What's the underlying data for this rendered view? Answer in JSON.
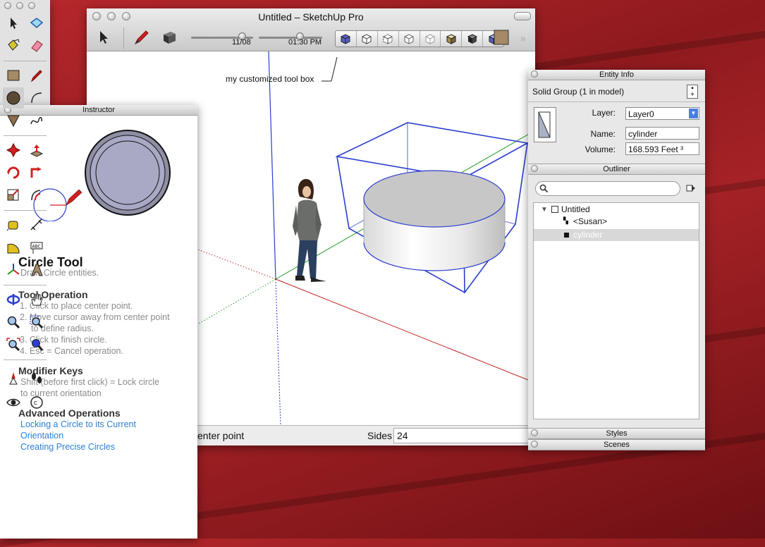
{
  "main_window": {
    "title": "Untitled – SketchUp Pro",
    "date_label": "11/08",
    "time_label": "01:30 PM",
    "callout": "my customized tool box",
    "status_text": "enter point",
    "sides_label": "Sides",
    "sides_value": "24",
    "view_icons": [
      "iso-view-icon",
      "top-view-icon",
      "front-view-icon",
      "right-view-icon",
      "back-view-icon",
      "left-view-icon",
      "bottom-view-icon",
      "shadow-view-icon"
    ]
  },
  "instructor": {
    "title": "Instructor",
    "tool_name": "Circle Tool",
    "tool_desc": "Draw Circle entities.",
    "operation_heading": "Tool Operation",
    "steps": [
      "1.  Click to place center point.",
      "2.  Move cursor away from center point",
      "to define radius.",
      "3.  Click to finish circle.",
      "4.  Esc = Cancel operation."
    ],
    "modifier_heading": "Modifier Keys",
    "modifier_lines": [
      "Shift (before first click) = Lock circle",
      "to current orientation"
    ],
    "advanced_heading": "Advanced Operations",
    "links": [
      "Locking a Circle to its Current",
      "Orientation",
      "Creating Precise Circles"
    ]
  },
  "entity_info": {
    "title": "Entity Info",
    "selection": "Solid Group (1 in model)",
    "layer_label": "Layer:",
    "layer_value": "Layer0",
    "name_label": "Name:",
    "name_value": "cylinder",
    "volume_label": "Volume:",
    "volume_value": "168.593 Feet ³"
  },
  "outliner": {
    "title": "Outliner",
    "search_placeholder": "",
    "root": "Untitled",
    "items": [
      "<Susan>",
      "cylinder"
    ]
  },
  "styles_title": "Styles",
  "scenes_title": "Scenes",
  "colors": {
    "accent_blue": "#2a3fcf",
    "selection_gray": "#d8d8d8",
    "link_blue": "#2b7fd6",
    "desktop_red": "#a52226"
  }
}
